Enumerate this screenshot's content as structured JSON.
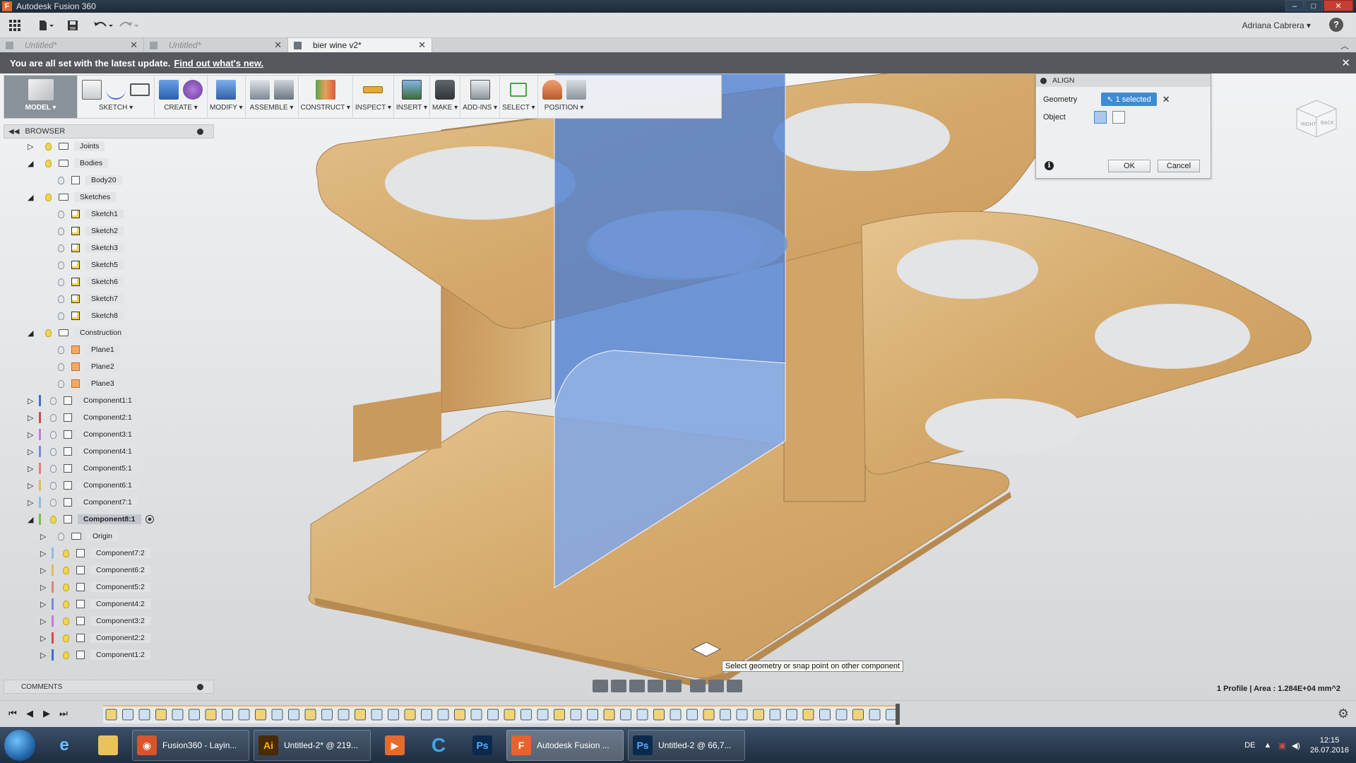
{
  "window": {
    "title": "Autodesk Fusion 360"
  },
  "user": {
    "name": "Adriana Cabrera ▾"
  },
  "tabs": [
    {
      "label": "Untitled*"
    },
    {
      "label": "Untitled*"
    },
    {
      "label": "bier wine v2*"
    }
  ],
  "notification": {
    "text": "You are all set with the latest update.",
    "link": "Find out what's new."
  },
  "toolbar": {
    "groups": [
      {
        "label": "MODEL ▾"
      },
      {
        "label": "SKETCH ▾"
      },
      {
        "label": "CREATE ▾"
      },
      {
        "label": "MODIFY ▾"
      },
      {
        "label": "ASSEMBLE ▾"
      },
      {
        "label": "CONSTRUCT ▾"
      },
      {
        "label": "INSPECT ▾"
      },
      {
        "label": "INSERT ▾"
      },
      {
        "label": "MAKE ▾"
      },
      {
        "label": "ADD-INS ▾"
      },
      {
        "label": "SELECT ▾"
      },
      {
        "label": "POSITION ▾"
      }
    ]
  },
  "browser": {
    "title": "BROWSER",
    "items": [
      {
        "label": "Joints",
        "exp": "▷",
        "type": "folder",
        "bulb": "on",
        "indent": 0
      },
      {
        "label": "Bodies",
        "exp": "◢",
        "type": "folder",
        "bulb": "on",
        "indent": 0
      },
      {
        "label": "Body20",
        "exp": "",
        "type": "body",
        "bulb": "off",
        "indent": 1
      },
      {
        "label": "Sketches",
        "exp": "◢",
        "type": "folder",
        "bulb": "on",
        "indent": 0
      },
      {
        "label": "Sketch1",
        "exp": "",
        "type": "sketch",
        "bulb": "off",
        "indent": 1
      },
      {
        "label": "Sketch2",
        "exp": "",
        "type": "sketch",
        "bulb": "off",
        "indent": 1
      },
      {
        "label": "Sketch3",
        "exp": "",
        "type": "sketch",
        "bulb": "off",
        "indent": 1
      },
      {
        "label": "Sketch5",
        "exp": "",
        "type": "sketch",
        "bulb": "off",
        "indent": 1
      },
      {
        "label": "Sketch6",
        "exp": "",
        "type": "sketch",
        "bulb": "off",
        "indent": 1
      },
      {
        "label": "Sketch7",
        "exp": "",
        "type": "sketch",
        "bulb": "off",
        "indent": 1
      },
      {
        "label": "Sketch8",
        "exp": "",
        "type": "sketch",
        "bulb": "off",
        "indent": 1
      },
      {
        "label": "Construction",
        "exp": "◢",
        "type": "folder",
        "bulb": "on",
        "indent": 0
      },
      {
        "label": "Plane1",
        "exp": "",
        "type": "plane",
        "bulb": "off",
        "indent": 1
      },
      {
        "label": "Plane2",
        "exp": "",
        "type": "plane",
        "bulb": "off",
        "indent": 1
      },
      {
        "label": "Plane3",
        "exp": "",
        "type": "plane",
        "bulb": "off",
        "indent": 1
      },
      {
        "label": "Component1:1",
        "exp": "▷",
        "type": "component",
        "bulb": "off",
        "indent": 0,
        "color": "#3f6fd1"
      },
      {
        "label": "Component2:1",
        "exp": "▷",
        "type": "component",
        "bulb": "off",
        "indent": 0,
        "color": "#d84a4a"
      },
      {
        "label": "Component3:1",
        "exp": "▷",
        "type": "component",
        "bulb": "off",
        "indent": 0,
        "color": "#c77ad6"
      },
      {
        "label": "Component4:1",
        "exp": "▷",
        "type": "component",
        "bulb": "off",
        "indent": 0,
        "color": "#7a88e0"
      },
      {
        "label": "Component5:1",
        "exp": "▷",
        "type": "component",
        "bulb": "off",
        "indent": 0,
        "color": "#e28080"
      },
      {
        "label": "Component6:1",
        "exp": "▷",
        "type": "component",
        "bulb": "off",
        "indent": 0,
        "color": "#e6b85a"
      },
      {
        "label": "Component7:1",
        "exp": "▷",
        "type": "component",
        "bulb": "off",
        "indent": 0,
        "color": "#8cc0e6"
      },
      {
        "label": "Component8:1",
        "exp": "◢",
        "type": "component",
        "bulb": "on",
        "indent": 0,
        "color": "#7bbf4a",
        "bold": true
      },
      {
        "label": "Origin",
        "exp": "▷",
        "type": "folder",
        "bulb": "off",
        "indent": 1
      },
      {
        "label": "Component7:2",
        "exp": "▷",
        "type": "component",
        "bulb": "on",
        "indent": 1,
        "color": "#8cc0e6"
      },
      {
        "label": "Component6:2",
        "exp": "▷",
        "type": "component",
        "bulb": "on",
        "indent": 1,
        "color": "#e6b85a"
      },
      {
        "label": "Component5:2",
        "exp": "▷",
        "type": "component",
        "bulb": "on",
        "indent": 1,
        "color": "#e28080"
      },
      {
        "label": "Component4:2",
        "exp": "▷",
        "type": "component",
        "bulb": "on",
        "indent": 1,
        "color": "#7a88e0"
      },
      {
        "label": "Component3:2",
        "exp": "▷",
        "type": "component",
        "bulb": "on",
        "indent": 1,
        "color": "#c77ad6"
      },
      {
        "label": "Component2:2",
        "exp": "▷",
        "type": "component",
        "bulb": "on",
        "indent": 1,
        "color": "#d84a4a"
      },
      {
        "label": "Component1:2",
        "exp": "▷",
        "type": "component",
        "bulb": "on",
        "indent": 1,
        "color": "#3f6fd1"
      }
    ]
  },
  "comments": {
    "title": "COMMENTS"
  },
  "align_dialog": {
    "title": "ALIGN",
    "geometry_label": "Geometry",
    "geometry_value": "1 selected",
    "object_label": "Object",
    "ok": "OK",
    "cancel": "Cancel"
  },
  "viewcube": {
    "right": "RIGHT",
    "back": "BACK"
  },
  "tooltip": "Select geometry or snap point on other component",
  "status": "1 Profile | Area : 1.284E+04 mm^2",
  "taskbar": {
    "windows": [
      {
        "label": "Fusion360 - Layin...",
        "color": "#d9542a",
        "icon": "◉"
      },
      {
        "label": "Untitled-2* @ 219...",
        "color": "#4a2a00",
        "icon": "Ai"
      },
      {
        "label": "Autodesk Fusion ...",
        "color": "#e8632b",
        "icon": "F",
        "active": true
      },
      {
        "label": "Untitled-2 @ 66,7...",
        "color": "#0b2a4d",
        "icon": "Ps"
      }
    ],
    "language": "DE",
    "time": "12:15",
    "date": "26.07.2016"
  },
  "colors": {
    "accent": "#3d8bd4",
    "wood": "#d9b27a",
    "selection_plane": "#5a8bd8"
  }
}
